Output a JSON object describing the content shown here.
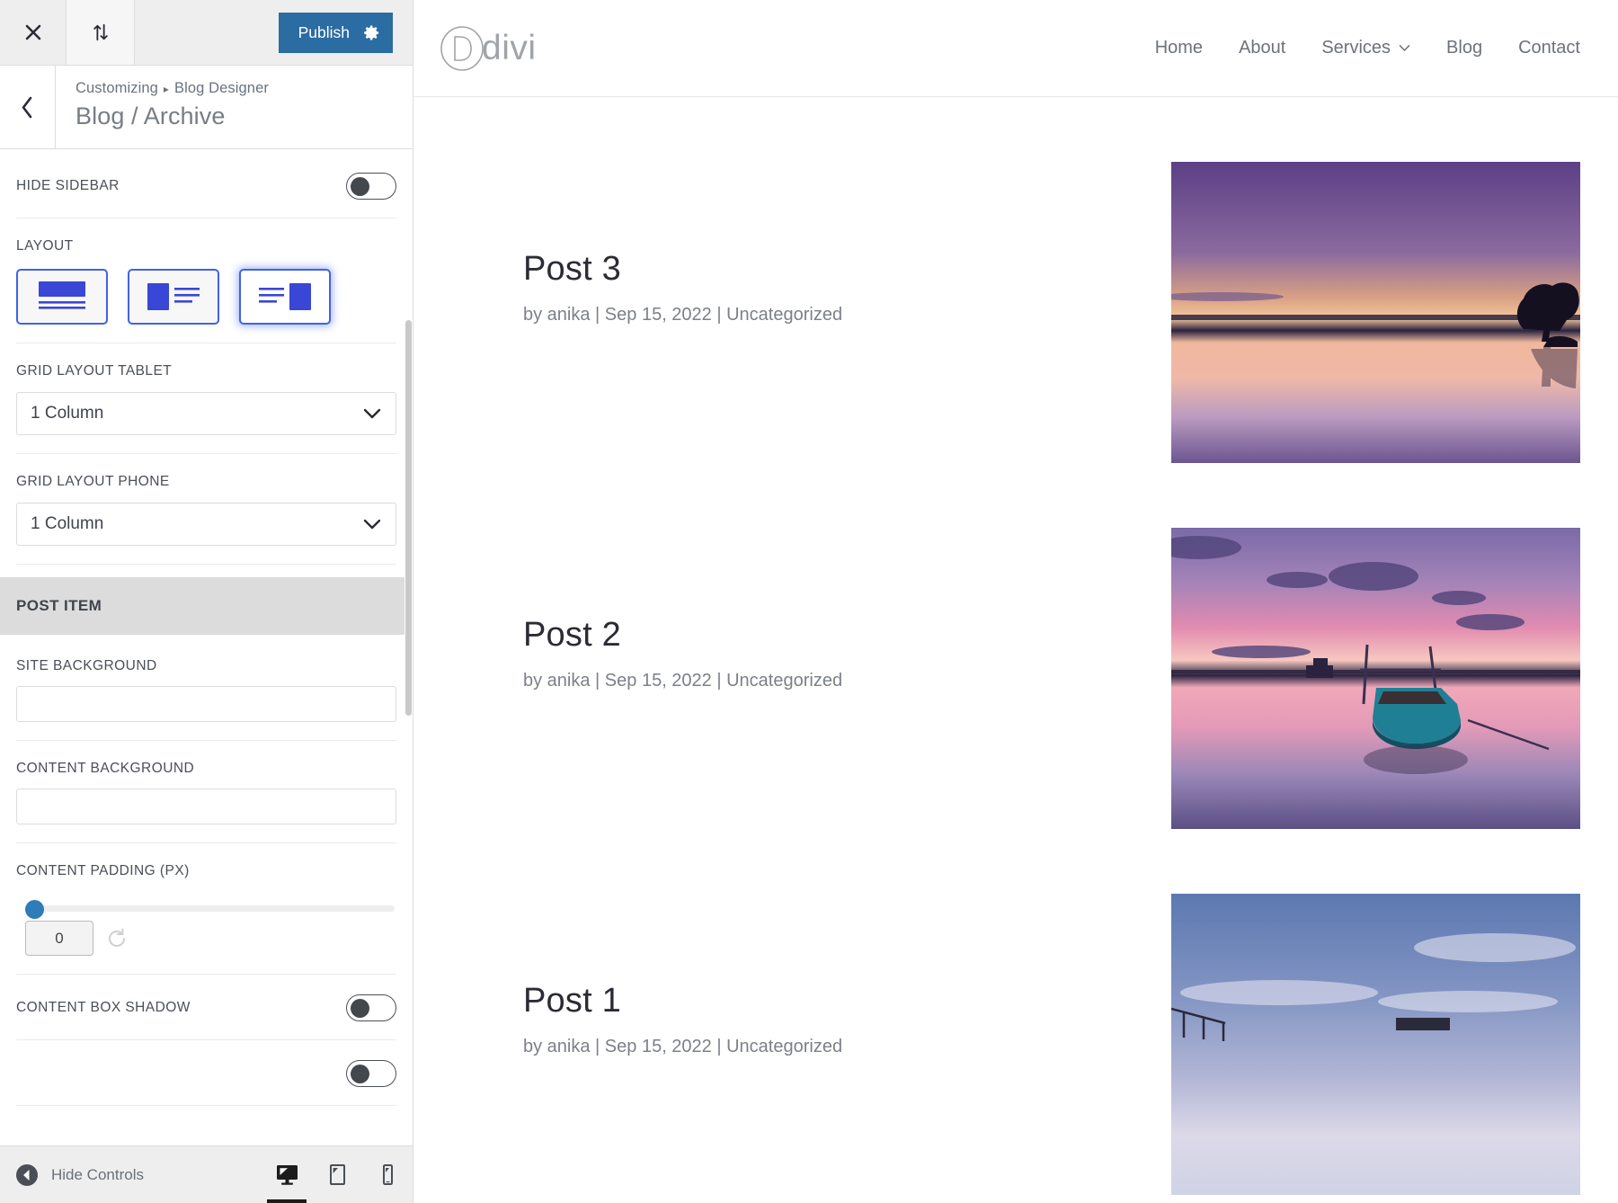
{
  "customizer": {
    "topbar": {
      "close_icon": "close-icon",
      "reorder_icon": "reorder-arrows-icon",
      "publish_label": "Publish",
      "gear_icon": "gear-icon"
    },
    "header": {
      "back_icon": "chevron-left-icon",
      "breadcrumb_root": "Customizing",
      "breadcrumb_separator": "▸",
      "breadcrumb_current": "Blog Designer",
      "page_title": "Blog / Archive"
    },
    "controls": [
      {
        "label": "HIDE SIDEBAR",
        "type": "toggle",
        "value": "off"
      },
      {
        "label": "LAYOUT",
        "type": "layout-picker",
        "selected_index": 2
      },
      {
        "label": "GRID LAYOUT TABLET",
        "type": "select",
        "value": "1 Column"
      },
      {
        "label": "GRID LAYOUT PHONE",
        "type": "select",
        "value": "1 Column"
      }
    ],
    "subsection": {
      "title": "POST ITEM"
    },
    "post_item_controls": [
      {
        "label": "SITE BACKGROUND",
        "type": "color",
        "value": ""
      },
      {
        "label": "CONTENT BACKGROUND",
        "type": "color",
        "value": ""
      },
      {
        "label": "CONTENT PADDING (PX)",
        "type": "slider",
        "value": "0"
      },
      {
        "label": "CONTENT BOX SHADOW",
        "type": "toggle",
        "value": "off"
      }
    ],
    "bottombar": {
      "hide_controls_label": "Hide Controls",
      "hide_controls_icon": "collapse-left-icon",
      "devices": [
        {
          "name": "desktop",
          "icon": "desktop-icon",
          "active": true
        },
        {
          "name": "tablet",
          "icon": "tablet-icon",
          "active": false
        },
        {
          "name": "phone",
          "icon": "phone-icon",
          "active": false
        }
      ]
    },
    "accent_blue": "#2b6ca3",
    "layout_blue": "#3a46d6",
    "slider_blue": "#2e7cb8"
  },
  "preview": {
    "brand": {
      "mark": "divi-circle-d-logo",
      "text": "divi"
    },
    "nav": [
      {
        "label": "Home",
        "has_caret": false
      },
      {
        "label": "About",
        "has_caret": false
      },
      {
        "label": "Services",
        "has_caret": true
      },
      {
        "label": "Blog",
        "has_caret": false
      },
      {
        "label": "Contact",
        "has_caret": false
      }
    ],
    "posts": [
      {
        "title": "Post 3",
        "meta": "by anika | Sep 15, 2022 | Uncategorized",
        "image": "purple-sunset-lone-tree-reflection"
      },
      {
        "title": "Post 2",
        "meta": "by anika | Sep 15, 2022 | Uncategorized",
        "image": "pink-sunset-teal-rowboat"
      },
      {
        "title": "Post 1",
        "meta": "by anika | Sep 15, 2022 | Uncategorized",
        "image": "blue-lavender-sky-pier"
      }
    ]
  }
}
